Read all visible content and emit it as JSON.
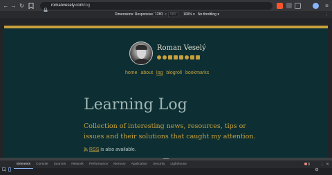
{
  "browser": {
    "url_host": "romanvesely.com",
    "url_path": "/log"
  },
  "device_toolbar": {
    "dimensions_label": "Dimensions: Responsive",
    "width_value": "1280",
    "times": "×",
    "height_placeholder": "980",
    "zoom": "100%",
    "throttling": "No throttling"
  },
  "site": {
    "author": "Roman Veselý",
    "nav": [
      "home",
      "about",
      "log",
      "blogroll",
      "bookmarks"
    ],
    "active_nav": "log",
    "title": "Learning Log",
    "subtitle": "Collection of interesting news, resources, tips or issues and their solutions that caught my attention.",
    "rss_link": "RSS",
    "rss_suffix": " is also available."
  },
  "devtools": {
    "tabs": [
      "Elements",
      "Console",
      "Sources",
      "Network",
      "Performance",
      "Memory",
      "Application",
      "Security",
      "Lighthouse"
    ],
    "active_tab": "Elements",
    "badge_count": "3"
  },
  "colors": {
    "page_bg": "#0d2f33",
    "accent": "#c7a03d",
    "title": "#9fb5b3"
  }
}
